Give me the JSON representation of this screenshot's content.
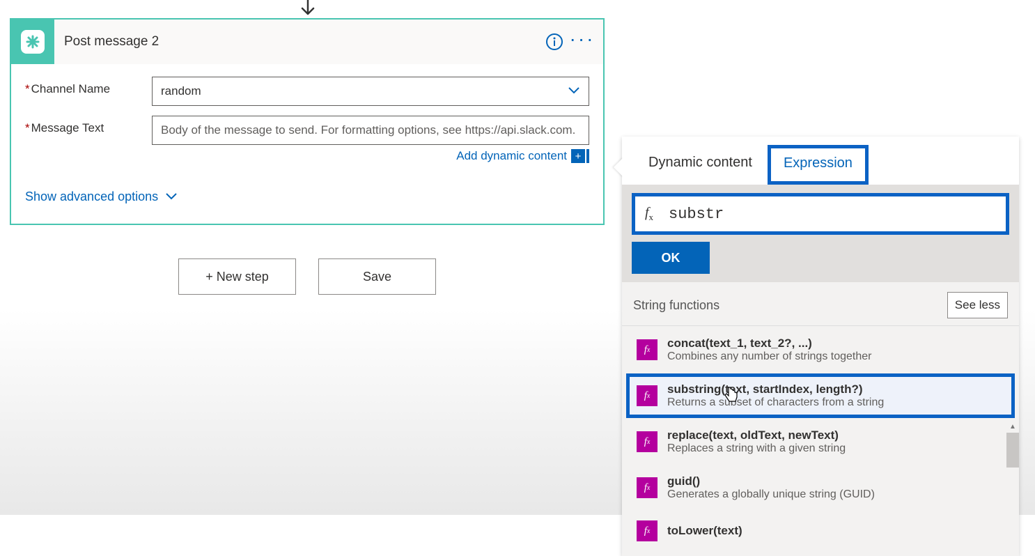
{
  "action": {
    "title": "Post message 2",
    "fields": {
      "channel_label": "Channel Name",
      "channel_value": "random",
      "message_label": "Message Text",
      "message_placeholder": "Body of the message to send. For formatting options, see https://api.slack.com."
    },
    "dynamic_link": "Add dynamic content",
    "advanced": "Show advanced options"
  },
  "buttons": {
    "new_step": "+ New step",
    "save": "Save"
  },
  "panel": {
    "tabs": {
      "dynamic": "Dynamic content",
      "expression": "Expression"
    },
    "expr_value": "substr",
    "ok": "OK",
    "section": "String functions",
    "see_less": "See less",
    "functions": [
      {
        "sig": "concat(text_1, text_2?, ...)",
        "desc": "Combines any number of strings together"
      },
      {
        "sig": "substring(text, startIndex, length?)",
        "desc": "Returns a subset of characters from a string"
      },
      {
        "sig": "replace(text, oldText, newText)",
        "desc": "Replaces a string with a given string"
      },
      {
        "sig": "guid()",
        "desc": "Generates a globally unique string (GUID)"
      },
      {
        "sig": "toLower(text)",
        "desc": ""
      }
    ],
    "highlight_index": 1
  }
}
